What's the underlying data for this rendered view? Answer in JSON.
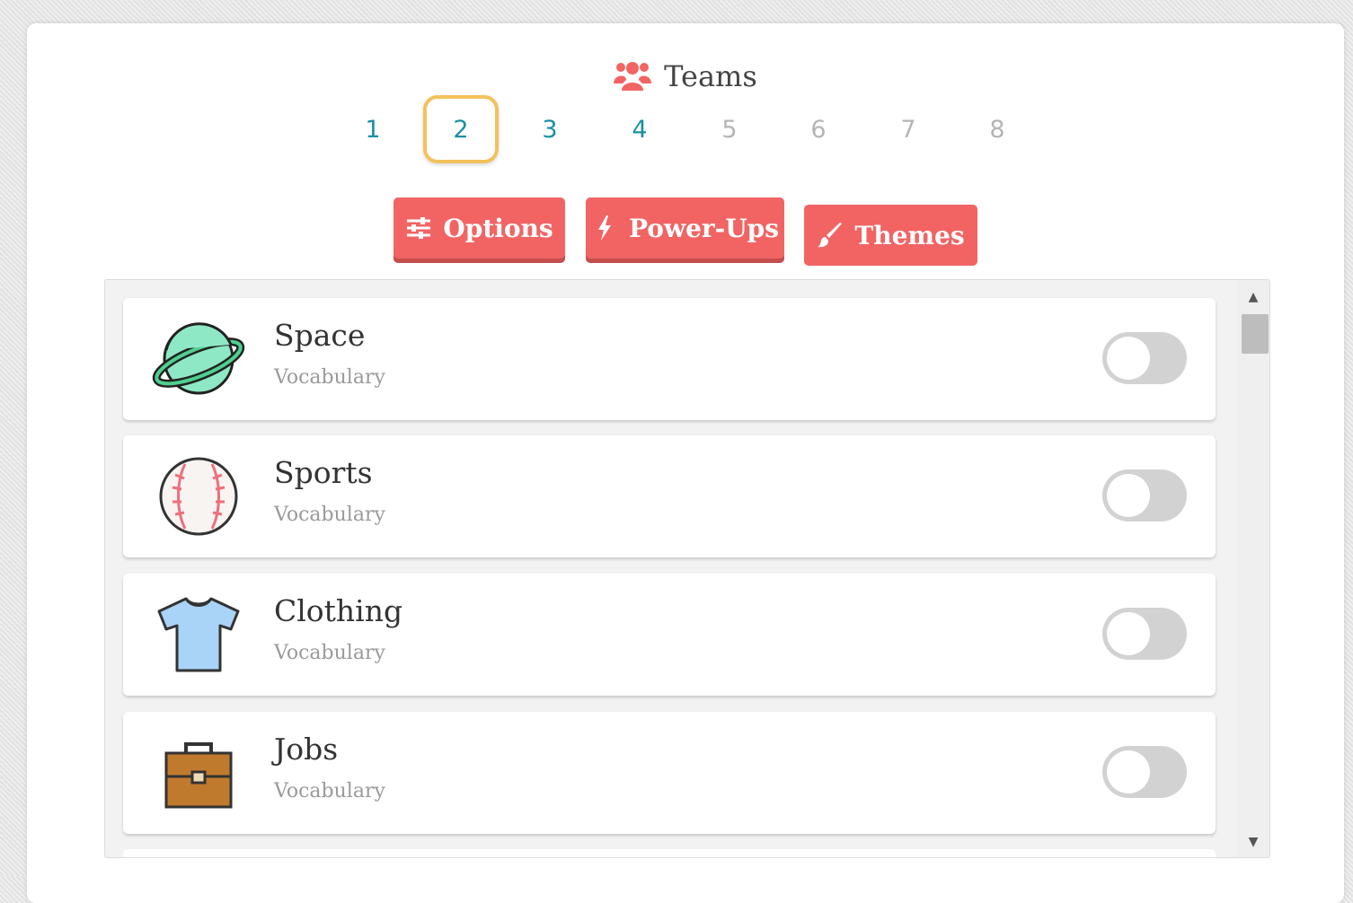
{
  "header": {
    "title": "Teams",
    "icon": "users-icon",
    "accent": "#f26464"
  },
  "teams": {
    "selected": "2",
    "items": [
      {
        "label": "1",
        "enabled": true
      },
      {
        "label": "2",
        "enabled": true
      },
      {
        "label": "3",
        "enabled": true
      },
      {
        "label": "4",
        "enabled": true
      },
      {
        "label": "5",
        "enabled": false
      },
      {
        "label": "6",
        "enabled": false
      },
      {
        "label": "7",
        "enabled": false
      },
      {
        "label": "8",
        "enabled": false
      }
    ]
  },
  "toolbar": {
    "options_label": "Options",
    "options_icon": "sliders-icon",
    "powerups_label": "Power-Ups",
    "powerups_icon": "bolt-icon",
    "themes_label": "Themes",
    "themes_icon": "paintbrush-icon",
    "button_color": "#f26464"
  },
  "themes": [
    {
      "title": "Space",
      "subtitle": "Vocabulary",
      "icon": "planet-icon",
      "enabled": false
    },
    {
      "title": "Sports",
      "subtitle": "Vocabulary",
      "icon": "baseball-icon",
      "enabled": false
    },
    {
      "title": "Clothing",
      "subtitle": "Vocabulary",
      "icon": "tshirt-icon",
      "enabled": false
    },
    {
      "title": "Jobs",
      "subtitle": "Vocabulary",
      "icon": "briefcase-icon",
      "enabled": false
    }
  ]
}
